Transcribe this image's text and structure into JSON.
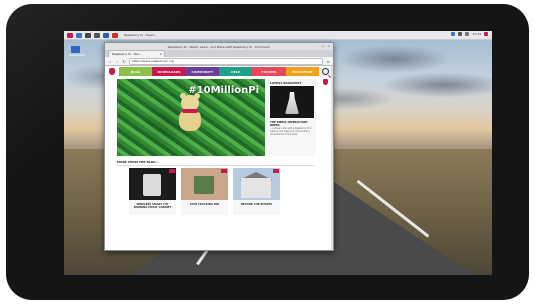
{
  "taskbar": {
    "window_title": "Raspberry Pi - Teach...",
    "clock": "13:44",
    "icon_colors": [
      "#c51a4a",
      "#3b6fc8",
      "#444444",
      "#555555",
      "#2f5fb0",
      "#d4302a",
      "#e07a1b"
    ]
  },
  "desktop": {
    "icon_label": "Wastebasket"
  },
  "browser": {
    "window_title": "Raspberry Pi - Teach, Learn, and Make with Raspberry Pi - Chromium",
    "tab_label": "Raspberry Pi - Tea...",
    "tab_close": "×",
    "url": "https://www.raspberrypi.org",
    "controls": {
      "minimize": "–",
      "maximize": "□",
      "close": "×"
    },
    "nav": {
      "back": "‹",
      "forward": "›",
      "reload": "↻",
      "menu": "≡"
    }
  },
  "site": {
    "nav": [
      {
        "label": "BLOG",
        "color": "#8cc04b"
      },
      {
        "label": "DOWNLOADS",
        "color": "#c51a4a"
      },
      {
        "label": "COMMUNITY",
        "color": "#6a3f99"
      },
      {
        "label": "HELP",
        "color": "#1fa089"
      },
      {
        "label": "FORUMS",
        "color": "#e8485c"
      },
      {
        "label": "EDUCATION",
        "color": "#f2a11d"
      }
    ],
    "hero_tag": "#10MillionPi",
    "latest_blogpost": {
      "heading": "LATEST BLOGPOST",
      "title": "THE SWEAL INTERACTION DRESS",
      "excerpt": "...a dress made with a Raspberry Pi to light up and respond to the wearer's movements for the show"
    },
    "more_heading": "MORE FROM THE BLOG...",
    "cards": [
      {
        "caption": "WIRELESS SMART CAT BURNING MUSIC CABINET"
      },
      {
        "caption": "FACE TRACKING BIN"
      },
      {
        "caption": "BEYOND THE ECHOES"
      }
    ]
  },
  "colors": {
    "accent": "#c51a4a",
    "hero_green": "#3a9a3a"
  }
}
